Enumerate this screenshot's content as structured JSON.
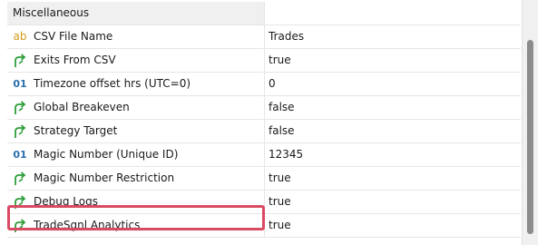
{
  "properties": {
    "group": {
      "label": "Miscellaneous"
    },
    "rows": [
      {
        "icon": "string-type-icon",
        "glyph": "ab",
        "name": "CSV File Name",
        "value": "Trades"
      },
      {
        "icon": "bool-type-icon",
        "glyph": "",
        "name": "Exits From CSV",
        "value": "true"
      },
      {
        "icon": "numeric-type-icon",
        "glyph": "01",
        "name": "Timezone offset hrs (UTC=0)",
        "value": "0"
      },
      {
        "icon": "bool-type-icon",
        "glyph": "",
        "name": "Global Breakeven",
        "value": "false"
      },
      {
        "icon": "bool-type-icon",
        "glyph": "",
        "name": "Strategy Target",
        "value": "false"
      },
      {
        "icon": "numeric-type-icon",
        "glyph": "01",
        "name": "Magic Number (Unique ID)",
        "value": "12345"
      },
      {
        "icon": "bool-type-icon",
        "glyph": "",
        "name": "Magic Number Restriction",
        "value": "true"
      },
      {
        "icon": "bool-type-icon",
        "glyph": "",
        "name": "Debug Logs",
        "value": "true"
      },
      {
        "icon": "bool-type-icon",
        "glyph": "",
        "name": "TradeSgnl Analytics",
        "value": "true"
      }
    ]
  },
  "colors": {
    "highlight_border": "#d94a63",
    "bool_icon": "#2e9e3a",
    "string_icon": "#d49a1a",
    "numeric_icon": "#2a6fae"
  }
}
